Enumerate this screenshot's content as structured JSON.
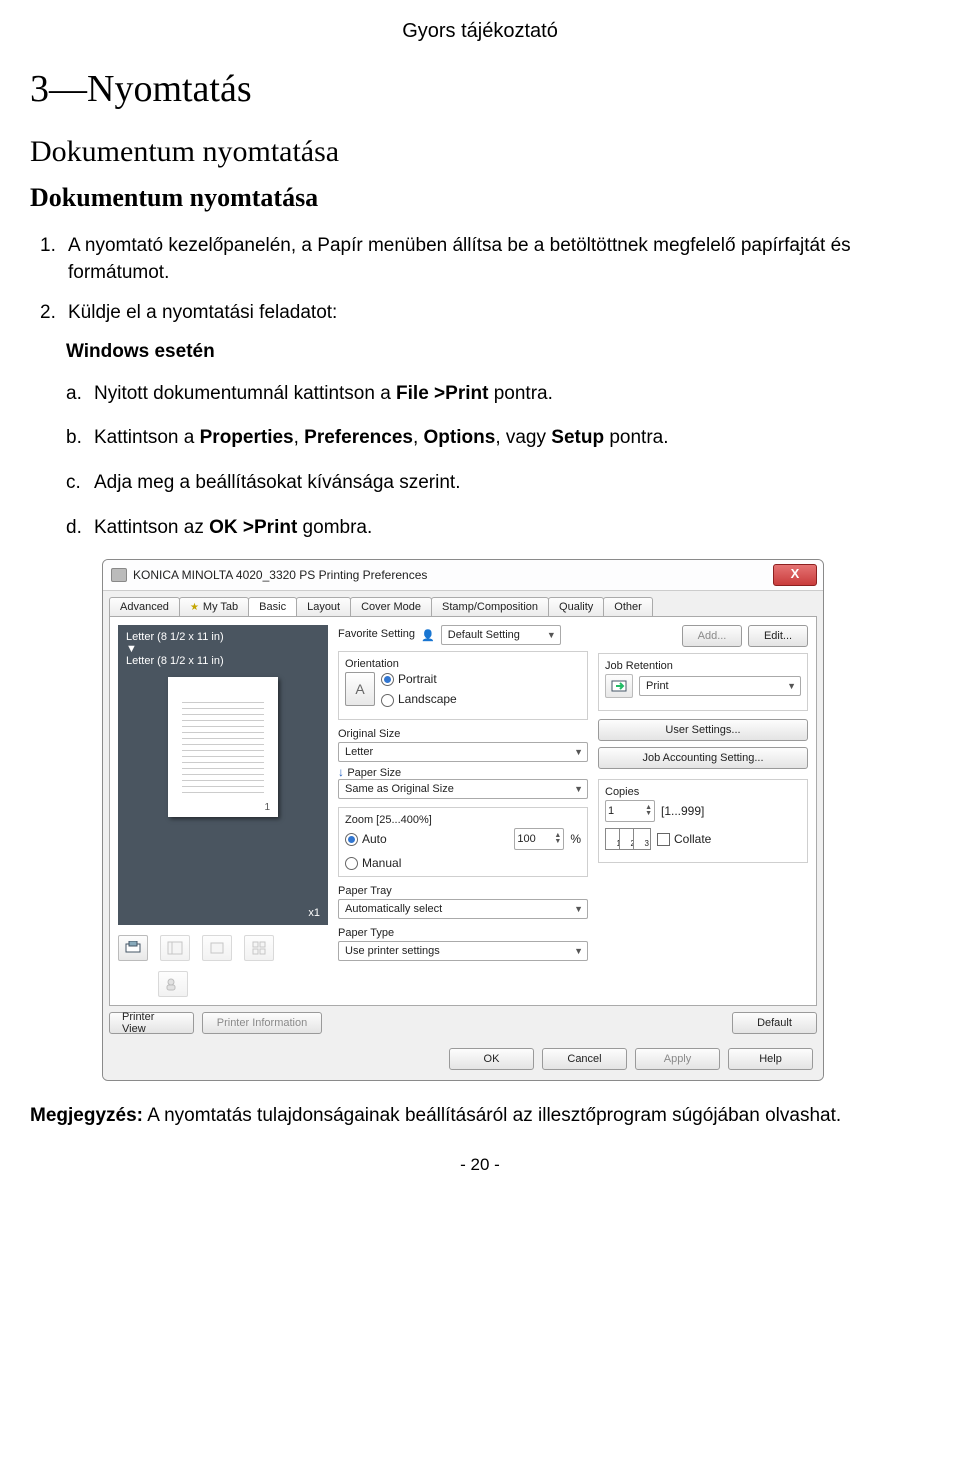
{
  "doc": {
    "header": "Gyors tájékoztató",
    "h1": "3—Nyomtatás",
    "h2": "Dokumentum nyomtatása",
    "h3": "Dokumentum nyomtatása",
    "step1_marker": "1.",
    "step1": "A nyomtató kezelőpanelén, a Papír menüben állítsa be a betöltöttnek megfelelő papírfajtát és formátumot.",
    "step2_marker": "2.",
    "step2": "Küldje el a nyomtatási feladatot:",
    "windows_label": "Windows esetén",
    "sub_a_marker": "a.",
    "sub_a_pre": "Nyitott dokumentumnál kattintson a ",
    "sub_a_bold": "File >Print",
    "sub_a_post": " pontra.",
    "sub_b_marker": "b.",
    "sub_b_pre": "Kattintson a ",
    "sub_b_b1": "Properties",
    "sub_b_s1": ", ",
    "sub_b_b2": "Preferences",
    "sub_b_s2": ", ",
    "sub_b_b3": "Options",
    "sub_b_s3": ", vagy ",
    "sub_b_b4": "Setup",
    "sub_b_post": " pontra.",
    "sub_c_marker": "c.",
    "sub_c": "Adja meg a beállításokat kívánsága szerint.",
    "sub_d_marker": "d.",
    "sub_d_pre": "Kattintson az ",
    "sub_d_bold": "OK >Print",
    "sub_d_post": " gombra.",
    "note_b": "Megjegyzés:",
    "note_t": " A nyomtatás tulajdonságainak beállításáról az illesztőprogram súgójában olvashat.",
    "page_number": "- 20 -"
  },
  "dlg": {
    "title": "KONICA MINOLTA 4020_3320 PS Printing Preferences",
    "close": "X",
    "tabs": [
      "Advanced",
      "My Tab",
      "Basic",
      "Layout",
      "Cover Mode",
      "Stamp/Composition",
      "Quality",
      "Other"
    ],
    "preview_line1": "Letter (8 1/2 x 11 in)",
    "preview_line2": "Letter (8 1/2 x 11 in)",
    "preview_pagenum": "1",
    "preview_x1": "x1",
    "printer_view": "Printer View",
    "printer_info": "Printer Information",
    "fav_label": "Favorite Setting",
    "fav_value": "Default Setting",
    "add": "Add...",
    "edit": "Edit...",
    "orientation": "Orientation",
    "portrait": "Portrait",
    "landscape": "Landscape",
    "original_size": "Original Size",
    "original_value": "Letter",
    "paper_size": "Paper Size",
    "paper_value": "Same as Original Size",
    "zoom_label": "Zoom [25...400%]",
    "zoom_auto": "Auto",
    "zoom_manual": "Manual",
    "zoom_value": "100",
    "zoom_pct": "%",
    "paper_tray": "Paper Tray",
    "tray_value": "Automatically select",
    "paper_type": "Paper Type",
    "type_value": "Use printer settings",
    "job_ret": "Job Retention",
    "job_ret_val": "Print",
    "user_settings": "User Settings...",
    "job_acct": "Job Accounting Setting...",
    "copies": "Copies",
    "copies_val": "1",
    "copies_range": "[1...999]",
    "collate": "Collate",
    "default": "Default",
    "ok": "OK",
    "cancel": "Cancel",
    "apply": "Apply",
    "help": "Help"
  }
}
